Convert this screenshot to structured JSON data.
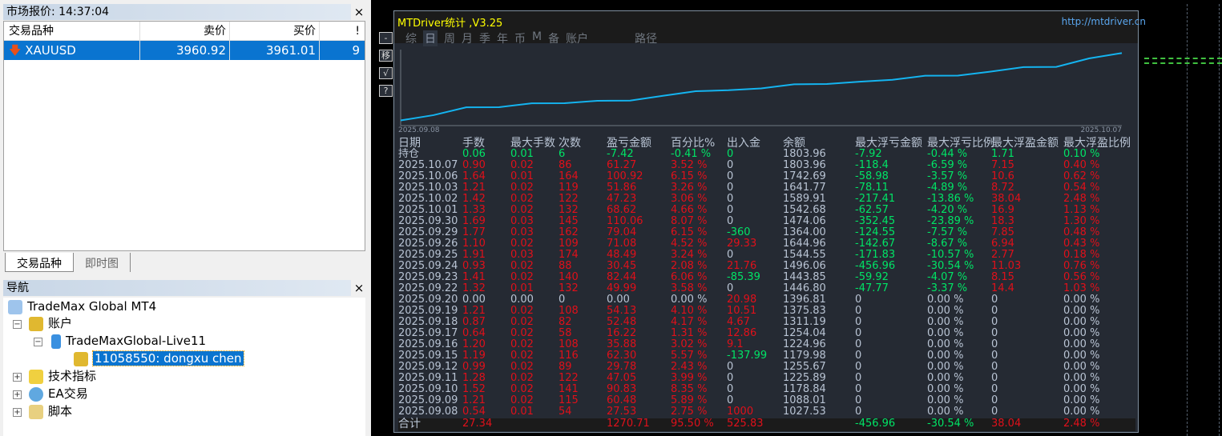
{
  "market_watch": {
    "title": "市场报价: 14:37:04",
    "close": "×",
    "headers": [
      "交易品种",
      "卖价",
      "买价",
      "!"
    ],
    "rows": [
      {
        "symbol": "XAUUSD",
        "bid": "3960.92",
        "ask": "3961.01",
        "spread": "9",
        "direction": "down"
      }
    ],
    "tabs": [
      "交易品种",
      "即时图"
    ]
  },
  "navigator": {
    "title": "导航",
    "items": [
      "TradeMax Global MT4",
      "账户",
      "TradeMaxGlobal-Live11",
      "11058550: dongxu chen",
      "技术指标",
      "EA交易",
      "脚本"
    ]
  },
  "panel": {
    "title": "MTDriver统计 ,V3.25",
    "url": "http://mtdriver.cn",
    "tabs": [
      "综",
      "日",
      "周",
      "月",
      "季",
      "年",
      "币",
      "M",
      "备",
      "账户",
      "路径"
    ],
    "active_tab": "日",
    "side_buttons": [
      "-",
      "移",
      "√",
      "?"
    ],
    "chart": {
      "start": "2025.09.08",
      "end": "2025.10.07",
      "line_color": "#14b4f0"
    },
    "columns": [
      "日期",
      "手数",
      "最大手数",
      "次数",
      "盈亏金额",
      "百分比%",
      "出入金",
      "余额",
      "最大浮亏金额",
      "最大浮亏比例",
      "最大浮盈金额",
      "最大浮盈比例"
    ],
    "position_row": [
      "持仓",
      "0.06",
      "0.01",
      "6",
      "-7.42",
      "-0.41 %",
      "0",
      "1803.96",
      "-7.92",
      "-0.44 %",
      "1.71",
      "0.10 %"
    ],
    "rows": [
      [
        "2025.10.07",
        "0.90",
        "0.02",
        "86",
        "61.27",
        "3.52 %",
        "0",
        "1803.96",
        "-118.4",
        "-6.59 %",
        "7.15",
        "0.40 %"
      ],
      [
        "2025.10.06",
        "1.64",
        "0.01",
        "164",
        "100.92",
        "6.15 %",
        "0",
        "1742.69",
        "-58.98",
        "-3.57 %",
        "10.6",
        "0.62 %"
      ],
      [
        "2025.10.03",
        "1.21",
        "0.02",
        "119",
        "51.86",
        "3.26 %",
        "0",
        "1641.77",
        "-78.11",
        "-4.89 %",
        "8.72",
        "0.54 %"
      ],
      [
        "2025.10.02",
        "1.42",
        "0.02",
        "122",
        "47.23",
        "3.06 %",
        "0",
        "1589.91",
        "-217.41",
        "-13.86 %",
        "38.04",
        "2.48 %"
      ],
      [
        "2025.10.01",
        "1.33",
        "0.02",
        "132",
        "68.62",
        "4.66 %",
        "0",
        "1542.68",
        "-62.57",
        "-4.20 %",
        "16.9",
        "1.13 %"
      ],
      [
        "2025.09.30",
        "1.69",
        "0.03",
        "145",
        "110.06",
        "8.07 %",
        "0",
        "1474.06",
        "-352.45",
        "-23.89 %",
        "18.3",
        "1.30 %"
      ],
      [
        "2025.09.29",
        "1.77",
        "0.03",
        "162",
        "79.04",
        "6.15 %",
        "-360",
        "1364.00",
        "-124.55",
        "-7.57 %",
        "7.85",
        "0.48 %"
      ],
      [
        "2025.09.26",
        "1.10",
        "0.02",
        "109",
        "71.08",
        "4.52 %",
        "29.33",
        "1644.96",
        "-142.67",
        "-8.67 %",
        "6.94",
        "0.43 %"
      ],
      [
        "2025.09.25",
        "1.91",
        "0.03",
        "174",
        "48.49",
        "3.24 %",
        "0",
        "1544.55",
        "-171.83",
        "-10.57 %",
        "2.77",
        "0.18 %"
      ],
      [
        "2025.09.24",
        "0.93",
        "0.02",
        "88",
        "30.45",
        "2.08 %",
        "21.76",
        "1496.06",
        "-456.96",
        "-30.54 %",
        "11.03",
        "0.76 %"
      ],
      [
        "2025.09.23",
        "1.41",
        "0.02",
        "140",
        "82.44",
        "6.06 %",
        "-85.39",
        "1443.85",
        "-59.92",
        "-4.07 %",
        "8.15",
        "0.56 %"
      ],
      [
        "2025.09.22",
        "1.32",
        "0.01",
        "132",
        "49.99",
        "3.58 %",
        "0",
        "1446.80",
        "-47.77",
        "-3.37 %",
        "14.4",
        "1.03 %"
      ],
      [
        "2025.09.20",
        "0.00",
        "0.00",
        "0",
        "0.00",
        "0.00 %",
        "20.98",
        "1396.81",
        "0",
        "0.00 %",
        "0",
        "0.00 %"
      ],
      [
        "2025.09.19",
        "1.21",
        "0.02",
        "108",
        "54.13",
        "4.10 %",
        "10.51",
        "1375.83",
        "0",
        "0.00 %",
        "0",
        "0.00 %"
      ],
      [
        "2025.09.18",
        "0.87",
        "0.02",
        "82",
        "52.48",
        "4.17 %",
        "4.67",
        "1311.19",
        "0",
        "0.00 %",
        "0",
        "0.00 %"
      ],
      [
        "2025.09.17",
        "0.64",
        "0.02",
        "58",
        "16.22",
        "1.31 %",
        "12.86",
        "1254.04",
        "0",
        "0.00 %",
        "0",
        "0.00 %"
      ],
      [
        "2025.09.16",
        "1.20",
        "0.02",
        "108",
        "35.88",
        "3.02 %",
        "9.1",
        "1224.96",
        "0",
        "0.00 %",
        "0",
        "0.00 %"
      ],
      [
        "2025.09.15",
        "1.19",
        "0.02",
        "116",
        "62.30",
        "5.57 %",
        "-137.99",
        "1179.98",
        "0",
        "0.00 %",
        "0",
        "0.00 %"
      ],
      [
        "2025.09.12",
        "0.99",
        "0.02",
        "89",
        "29.78",
        "2.43 %",
        "0",
        "1255.67",
        "0",
        "0.00 %",
        "0",
        "0.00 %"
      ],
      [
        "2025.09.11",
        "1.28",
        "0.02",
        "122",
        "47.05",
        "3.99 %",
        "0",
        "1225.89",
        "0",
        "0.00 %",
        "0",
        "0.00 %"
      ],
      [
        "2025.09.10",
        "1.52",
        "0.02",
        "141",
        "90.83",
        "8.35 %",
        "0",
        "1178.84",
        "0",
        "0.00 %",
        "0",
        "0.00 %"
      ],
      [
        "2025.09.09",
        "1.21",
        "0.02",
        "115",
        "60.48",
        "5.89 %",
        "0",
        "1088.01",
        "0",
        "0.00 %",
        "0",
        "0.00 %"
      ],
      [
        "2025.09.08",
        "0.54",
        "0.01",
        "54",
        "27.53",
        "2.75 %",
        "1000",
        "1027.53",
        "0",
        "0.00 %",
        "0",
        "0.00 %"
      ]
    ],
    "total_row": [
      "合计",
      "27.34",
      "",
      "",
      "1270.71",
      "95.50 %",
      "525.83",
      "",
      "-456.96",
      "-30.54 %",
      "38.04",
      "2.48 %"
    ],
    "colors": {
      "positive": "#e0101a",
      "negative": "#00e466",
      "neutral": "#b9c4d4"
    }
  }
}
